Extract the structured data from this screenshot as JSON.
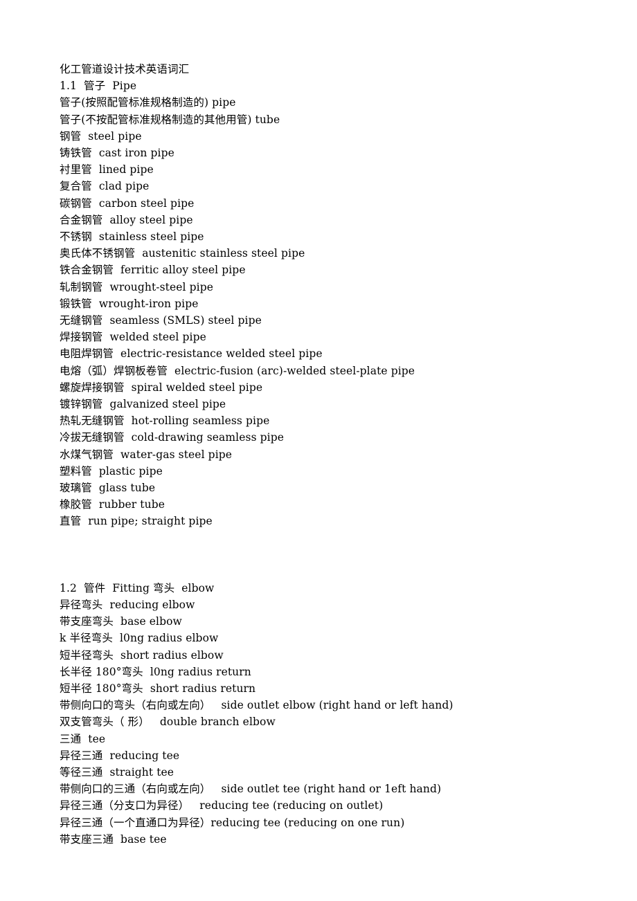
{
  "document": {
    "title": "化工管道设计技术英语词汇",
    "background_color": "#ffffff",
    "text_color": "#000000"
  },
  "sections": [
    {
      "heading": "1.1  管子  Pipe",
      "entries": [
        "管子(按照配管标准规格制造的) pipe",
        "管子(不按配管标准规格制造的其他用管) tube",
        "钢管  steel pipe",
        "铸铁管  cast iron pipe",
        "衬里管  lined pipe",
        "复合管  clad pipe",
        "碳钢管  carbon steel pipe",
        "合金钢管  alloy steel pipe",
        "不锈钢  stainless steel pipe",
        "奥氏体不锈钢管  austenitic stainless steel pipe",
        "铁合金钢管  ferritic alloy steel pipe",
        "轧制钢管  wrought-steel pipe",
        "锻铁管  wrought-iron pipe",
        "无缝钢管  seamless (SMLS) steel pipe",
        "焊接钢管  welded steel pipe",
        "电阻焊钢管  electric-resistance welded steel pipe",
        "电熔（弧）焊钢板卷管  electric-fusion (arc)-welded steel-plate pipe",
        "螺旋焊接钢管  spiral welded steel pipe",
        "镀锌钢管  galvanized steel pipe",
        "热轧无缝钢管  hot-rolling seamless pipe",
        "冷拔无缝钢管  cold-drawing seamless pipe",
        "水煤气钢管  water-gas steel pipe",
        "塑料管  plastic pipe",
        "玻璃管  glass tube",
        "橡胶管  rubber tube",
        "直管  run pipe; straight pipe"
      ]
    },
    {
      "heading": "1.2  管件  Fitting 弯头  elbow",
      "entries": [
        "异径弯头  reducing elbow",
        "带支座弯头  base elbow",
        "k 半径弯头  l0ng radius elbow",
        "短半径弯头  short radius elbow",
        "长半径 180°弯头  l0ng radius return",
        "短半径 180°弯头  short radius return",
        "带侧向口的弯头（右向或左向）   side outlet elbow (right hand or left hand)",
        "双支管弯头（ 形）   double branch elbow",
        "三通  tee",
        "异径三通  reducing tee",
        "等径三通  straight tee",
        "带侧向口的三通（右向或左向）   side outlet tee (right hand or 1eft hand)",
        "异径三通（分支口为异径）   reducing tee (reducing on outlet)",
        "异径三通（一个直通口为异径）reducing tee (reducing on one run)",
        "带支座三通  base tee"
      ]
    }
  ]
}
